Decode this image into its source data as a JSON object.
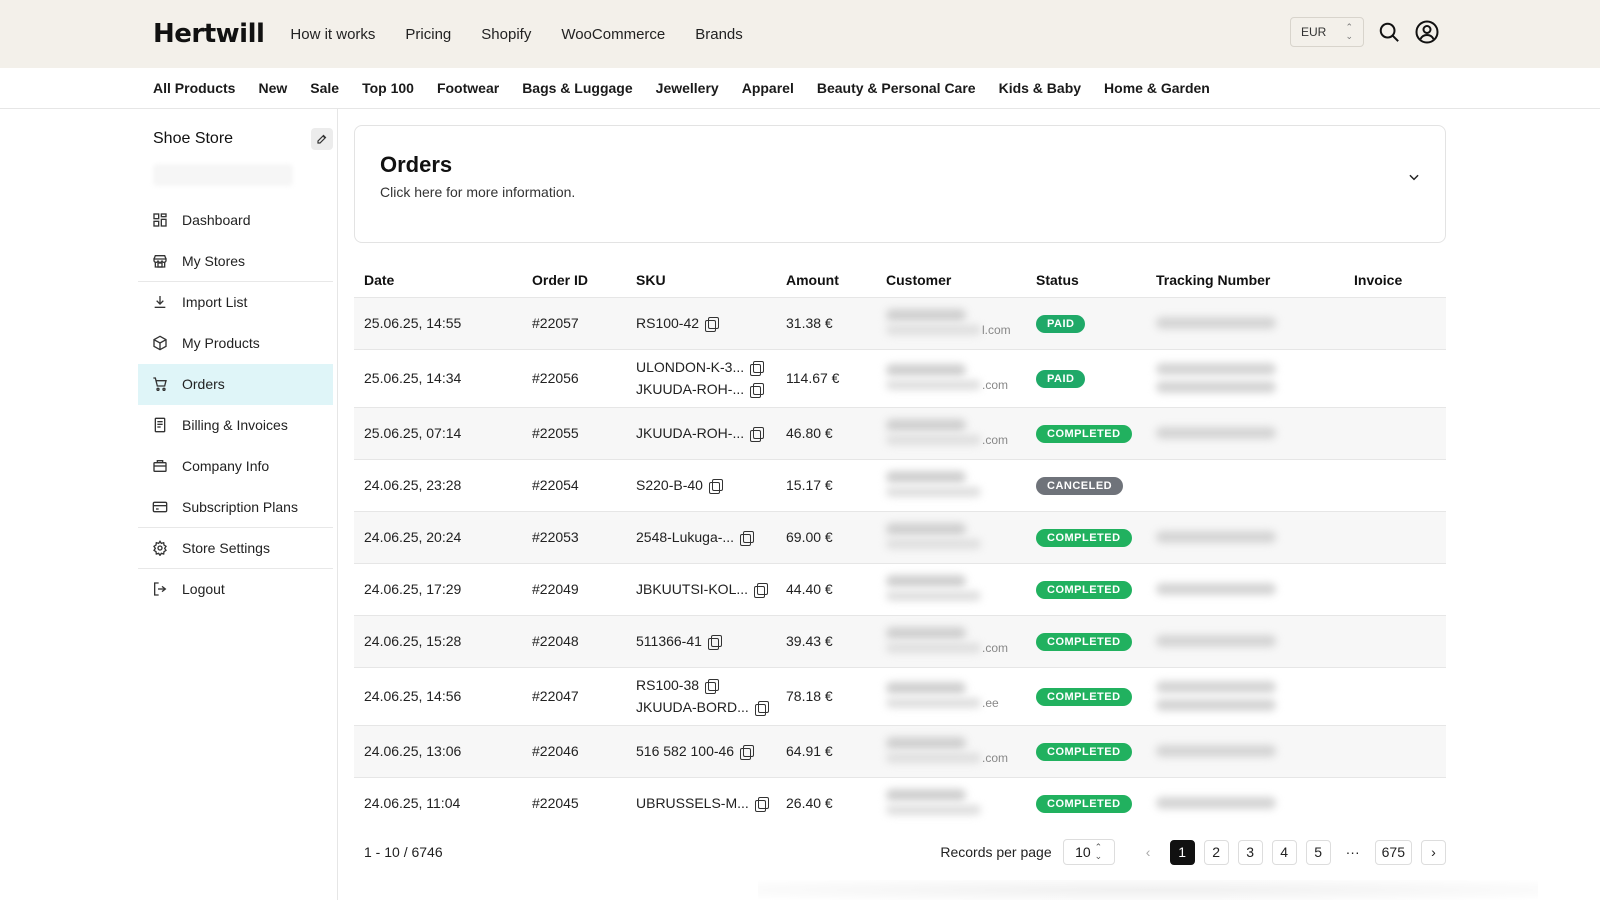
{
  "brand": {
    "logo": "Hertwill"
  },
  "top_nav": [
    "How it works",
    "Pricing",
    "Shopify",
    "WooCommerce",
    "Brands"
  ],
  "currency": {
    "value": "EUR"
  },
  "categories": [
    "All Products",
    "New",
    "Sale",
    "Top 100",
    "Footwear",
    "Bags & Luggage",
    "Jewellery",
    "Apparel",
    "Beauty & Personal Care",
    "Kids & Baby",
    "Home & Garden"
  ],
  "sidebar": {
    "store_name": "Shoe Store",
    "items": [
      {
        "label": "Dashboard",
        "icon": "dashboard-icon"
      },
      {
        "label": "My Stores",
        "icon": "store-icon"
      },
      {
        "label": "Import List",
        "icon": "download-icon"
      },
      {
        "label": "My Products",
        "icon": "box-icon"
      },
      {
        "label": "Orders",
        "icon": "cart-icon",
        "active": true
      },
      {
        "label": "Billing & Invoices",
        "icon": "invoice-icon"
      },
      {
        "label": "Company Info",
        "icon": "briefcase-icon"
      },
      {
        "label": "Subscription Plans",
        "icon": "card-icon"
      },
      {
        "label": "Store Settings",
        "icon": "gear-icon"
      },
      {
        "label": "Logout",
        "icon": "logout-icon"
      }
    ]
  },
  "orders": {
    "title": "Orders",
    "subtitle": "Click here for more information."
  },
  "table": {
    "headers": [
      "Date",
      "Order ID",
      "SKU",
      "Amount",
      "Customer",
      "Status",
      "Tracking Number",
      "Invoice"
    ],
    "rows": [
      {
        "date": "25.06.25, 14:55",
        "id": "#22057",
        "sku": [
          "RS100-42"
        ],
        "amount": "31.38 €",
        "cust_tail": "l.com",
        "status": "PAID",
        "track": 1
      },
      {
        "date": "25.06.25, 14:34",
        "id": "#22056",
        "sku": [
          "ULONDON-K-3...",
          "JKUUDA-ROH-..."
        ],
        "amount": "114.67 €",
        "cust_tail": ".com",
        "status": "PAID",
        "track": 2
      },
      {
        "date": "25.06.25, 07:14",
        "id": "#22055",
        "sku": [
          "JKUUDA-ROH-..."
        ],
        "amount": "46.80 €",
        "cust_tail": ".com",
        "status": "COMPLETED",
        "track": 1
      },
      {
        "date": "24.06.25, 23:28",
        "id": "#22054",
        "sku": [
          "S220-B-40"
        ],
        "amount": "15.17 €",
        "cust_tail": "",
        "status": "CANCELED",
        "track": 0
      },
      {
        "date": "24.06.25, 20:24",
        "id": "#22053",
        "sku": [
          "2548-Lukuga-..."
        ],
        "amount": "69.00 €",
        "cust_tail": "",
        "status": "COMPLETED",
        "track": 1
      },
      {
        "date": "24.06.25, 17:29",
        "id": "#22049",
        "sku": [
          "JBKUUTSI-KOL..."
        ],
        "amount": "44.40 €",
        "cust_tail": "",
        "status": "COMPLETED",
        "track": 1
      },
      {
        "date": "24.06.25, 15:28",
        "id": "#22048",
        "sku": [
          "511366-41"
        ],
        "amount": "39.43 €",
        "cust_tail": ".com",
        "status": "COMPLETED",
        "track": 1
      },
      {
        "date": "24.06.25, 14:56",
        "id": "#22047",
        "sku": [
          "RS100-38",
          "JKUUDA-BORD..."
        ],
        "amount": "78.18 €",
        "cust_tail": ".ee",
        "status": "COMPLETED",
        "track": 2
      },
      {
        "date": "24.06.25, 13:06",
        "id": "#22046",
        "sku": [
          "516 582 100-46"
        ],
        "amount": "64.91 €",
        "cust_tail": ".com",
        "status": "COMPLETED",
        "track": 1
      },
      {
        "date": "24.06.25, 11:04",
        "id": "#22045",
        "sku": [
          "UBRUSSELS-M..."
        ],
        "amount": "26.40 €",
        "cust_tail": "",
        "status": "COMPLETED",
        "track": 1
      }
    ]
  },
  "pagination": {
    "records": "1 - 10 / 6746",
    "per_page_label": "Records per page",
    "per_page": "10",
    "prev": "‹",
    "pages": [
      "1",
      "2",
      "3",
      "4",
      "5"
    ],
    "ellipsis": "···",
    "last": "675",
    "next": "›"
  },
  "colors": {
    "accent_active": "#dff5f8",
    "badge_green": "#21b15f",
    "badge_gray": "#6f737a",
    "topbar": "#f3f0ea"
  }
}
